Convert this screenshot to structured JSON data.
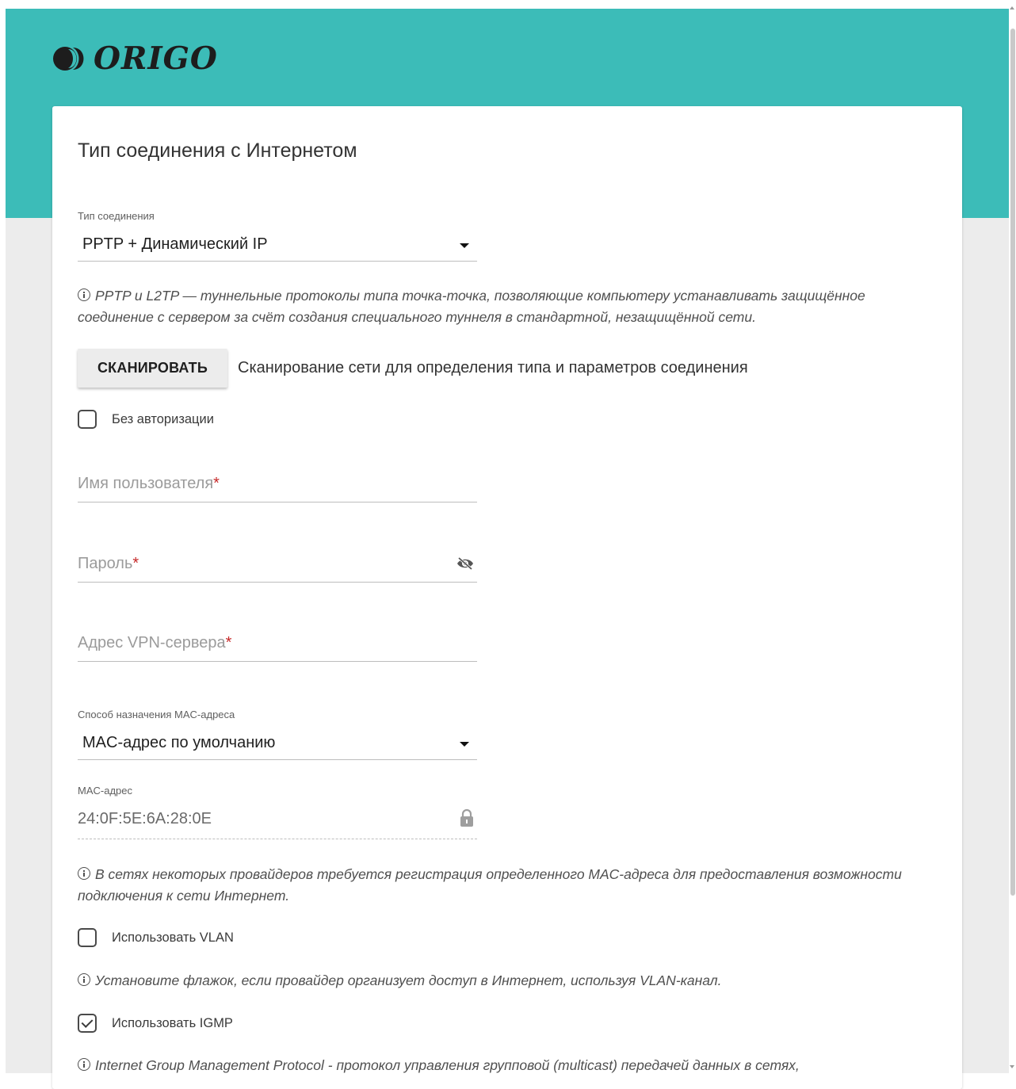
{
  "brand": {
    "logo_text": "ORIGO",
    "header_color": "#3cbcb8"
  },
  "page": {
    "title": "Тип соединения с Интернетом"
  },
  "connection_type": {
    "label": "Тип соединения",
    "value": "PPTP + Динамический IP"
  },
  "info_pptp": "PPTP и L2TP — туннельные протоколы типа точка-точка, позволяющие компьютеру устанавливать защищённое соединение с сервером за счёт создания специального туннеля в стандартной, незащищённой сети.",
  "scan": {
    "button_label": "СКАНИРОВАТЬ",
    "description": "Сканирование сети для определения типа и параметров соединения"
  },
  "no_auth": {
    "label": "Без авторизации",
    "checked": false
  },
  "username": {
    "placeholder": "Имя пользователя",
    "required_mark": "*"
  },
  "password": {
    "placeholder": "Пароль",
    "required_mark": "*"
  },
  "vpn_server": {
    "placeholder": "Адрес VPN-сервера",
    "required_mark": "*"
  },
  "mac_method": {
    "label": "Способ назначения MAC-адреса",
    "value": "MAC-адрес по умолчанию"
  },
  "mac_address": {
    "label": "MAC-адрес",
    "value": "24:0F:5E:6A:28:0E"
  },
  "info_mac": "В сетях некоторых провайдеров требуется регистрация определенного MAC-адреса для предоставления возможности подключения к сети Интернет.",
  "vlan": {
    "label": "Использовать VLAN",
    "checked": false
  },
  "info_vlan": "Установите флажок, если провайдер организует доступ в Интернет, используя VLAN-канал.",
  "igmp": {
    "label": "Использовать IGMP",
    "checked": true
  },
  "info_igmp": "Internet Group Management Protocol - протокол управления групповой (multicast) передачей данных в сетях,"
}
